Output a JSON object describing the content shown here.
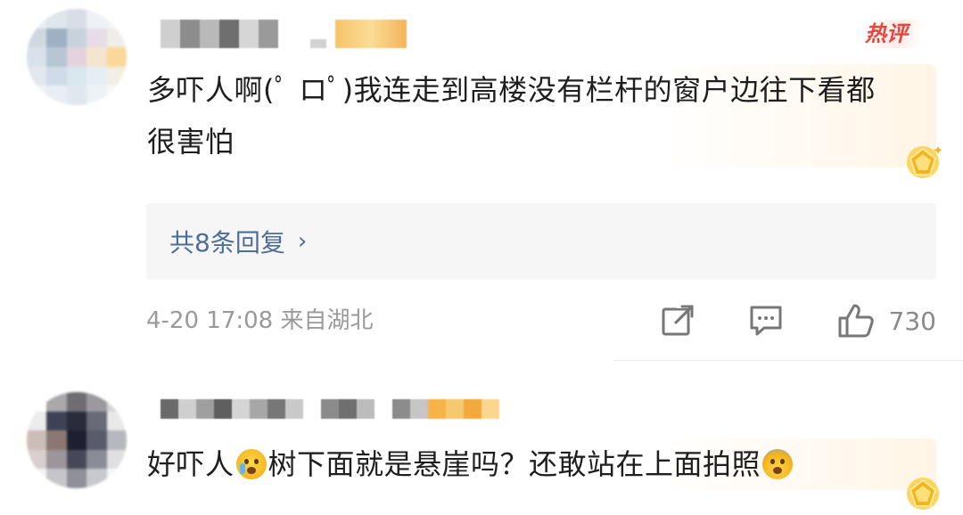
{
  "comments": [
    {
      "hot_tag": "热评",
      "text": "多吓人啊(ﾟ ロﾟ)我连走到高楼没有栏杆的窗户边往下看都很害怕",
      "replies_label": "共8条回复",
      "replies_chevron": "›",
      "meta": "4-20 17:08 来自湖北",
      "like_count": "730"
    },
    {
      "text_part1": "好吓人",
      "text_part2": "树下面就是悬崖吗？还敢站在上面拍照"
    }
  ],
  "colors": {
    "hot_tag": "#e8463c",
    "reply_link": "#4e6d9c",
    "meta": "#9a9a9a"
  },
  "icons": [
    "share-icon",
    "comment-icon",
    "like-icon",
    "crown-badge-icon",
    "crying-emoji",
    "scream-emoji"
  ]
}
